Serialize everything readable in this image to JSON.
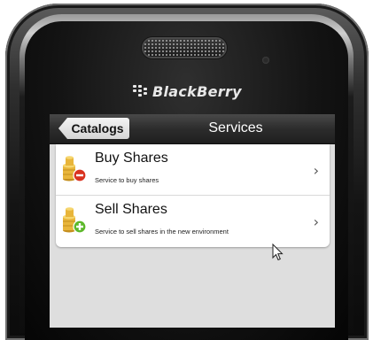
{
  "device": {
    "brand": "BlackBerry"
  },
  "titlebar": {
    "back_label": "Catalogs",
    "title": "Services"
  },
  "services": [
    {
      "title": "Buy Shares",
      "description": "Service to buy shares",
      "icon": "coins-remove-icon",
      "badge_color": "#d9321f"
    },
    {
      "title": "Sell Shares",
      "description": "Service to sell shares in the new environment",
      "icon": "coins-add-icon",
      "badge_color": "#5cb82a"
    }
  ],
  "chevron": "›",
  "colors": {
    "coin": "#e8b53a",
    "screen_bg": "#dedede"
  }
}
